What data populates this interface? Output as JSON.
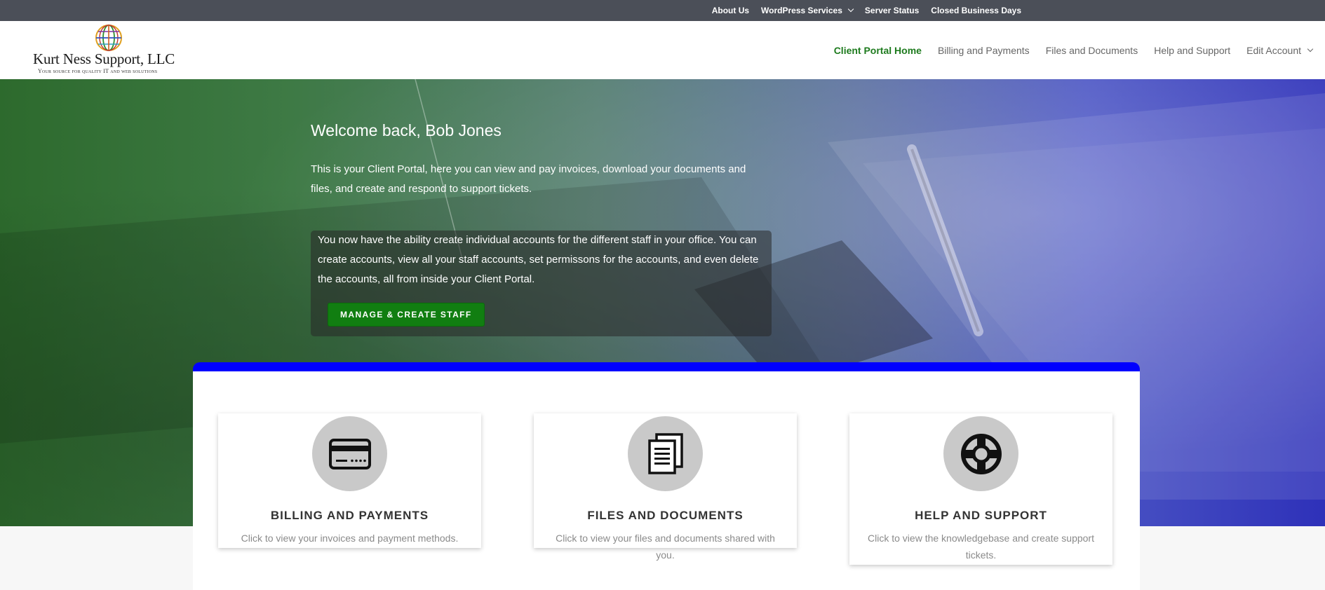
{
  "topbar": {
    "items": [
      {
        "label": "About Us"
      },
      {
        "label": "WordPress Services"
      },
      {
        "label": "Server Status"
      },
      {
        "label": "Closed Business Days"
      }
    ]
  },
  "logo": {
    "name": "Kurt Ness Support, LLC",
    "tagline": "Your source for quality IT and web solutions"
  },
  "nav": {
    "items": [
      {
        "label": "Client Portal Home"
      },
      {
        "label": "Billing and Payments"
      },
      {
        "label": "Files and Documents"
      },
      {
        "label": "Help and Support"
      },
      {
        "label": "Edit Account"
      }
    ]
  },
  "hero": {
    "title": "Welcome back, Bob Jones",
    "intro": "This is your Client Portal, here you can view and pay invoices, download your documents and files, and create and respond to support tickets.",
    "staff_text": "You now have the ability create individual accounts for the different staff in your office. You can create accounts, view all your staff accounts, set permissons for the accounts, and even delete the accounts, all from inside your Client Portal.",
    "staff_button": "MANAGE & CREATE STAFF"
  },
  "cards": [
    {
      "title": "BILLING AND PAYMENTS",
      "desc": "Click to view your invoices and payment methods.",
      "icon": "credit-card-icon"
    },
    {
      "title": "FILES AND DOCUMENTS",
      "desc": "Click to view your files and documents shared with you.",
      "icon": "documents-icon"
    },
    {
      "title": "HELP AND SUPPORT",
      "desc": "Click to view the knowledgebase and create support tickets.",
      "icon": "life-ring-icon"
    }
  ],
  "colors": {
    "topbar": "#4b4f58",
    "nav_active": "#1e7b1e",
    "staff_button": "#117e11",
    "panel_accent": "#0000ff"
  }
}
